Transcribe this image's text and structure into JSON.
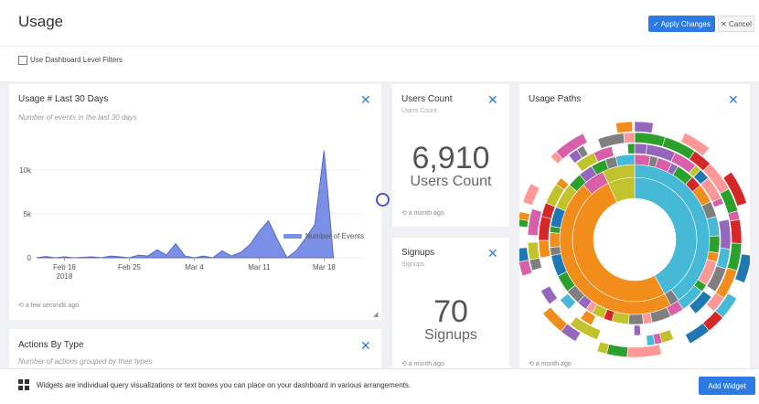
{
  "header": {
    "title": "Usage",
    "apply_label": "✓ Apply Changes",
    "cancel_label": "✕ Cancel"
  },
  "filters": {
    "label": "Use Dashboard Level Filters",
    "checked": false
  },
  "widgets": {
    "usage": {
      "title": "Usage # Last 30 Days",
      "subtitle": "Number of events in the last 30 days",
      "timestamp": "a few seconds ago"
    },
    "users_count": {
      "title": "Users Count",
      "subtitle": "Users Count",
      "value": "6,910",
      "label": "Users Count",
      "timestamp": "a month ago"
    },
    "signups": {
      "title": "Signups",
      "subtitle": "Signups",
      "value": "70",
      "label": "Signups",
      "timestamp": "a month ago"
    },
    "usage_paths": {
      "title": "Usage Paths",
      "timestamp": "a month ago"
    },
    "actions_by_type": {
      "title": "Actions By Type",
      "subtitle": "Number of actions grouped by their types"
    }
  },
  "footer": {
    "message": "Widgets are individual query visualizations or text boxes you can place on your dashboard in various arrangements.",
    "add_label": "Add Widget"
  },
  "icons": {
    "close": "close-icon",
    "clock": "clock-icon",
    "widgets": "widgets-icon",
    "resize": "resize-handle-icon",
    "drag": "drag-handle-icon"
  },
  "colors": {
    "accent": "#2c7be5",
    "series": "#7b8fe6"
  },
  "chart_data": {
    "type": "area",
    "title": "",
    "xlabel": "",
    "ylabel": "",
    "x_range": [
      "2018-02-15",
      "2018-03-22"
    ],
    "ylim": [
      0,
      13000
    ],
    "y_ticks": [
      0,
      5000,
      10000
    ],
    "y_tick_labels": [
      "0",
      "5k",
      "10k"
    ],
    "x_ticks": [
      "2018-02-18",
      "2018-02-25",
      "2018-03-04",
      "2018-03-11",
      "2018-03-18"
    ],
    "x_tick_labels": [
      "Feb 18",
      "Feb 25",
      "Mar 4",
      "Mar 11",
      "Mar 18"
    ],
    "x_tick_sublabel": "2018",
    "legend_position": "top-right",
    "series": [
      {
        "name": "Number of Events",
        "points": [
          [
            "2018-02-15",
            0
          ],
          [
            "2018-02-16",
            150
          ],
          [
            "2018-02-17",
            0
          ],
          [
            "2018-02-18",
            100
          ],
          [
            "2018-02-19",
            0
          ],
          [
            "2018-02-20",
            50
          ],
          [
            "2018-02-21",
            100
          ],
          [
            "2018-02-22",
            0
          ],
          [
            "2018-02-23",
            200
          ],
          [
            "2018-02-24",
            100
          ],
          [
            "2018-02-25",
            0
          ],
          [
            "2018-02-26",
            300
          ],
          [
            "2018-02-27",
            200
          ],
          [
            "2018-02-28",
            900
          ],
          [
            "2018-03-01",
            300
          ],
          [
            "2018-03-02",
            1600
          ],
          [
            "2018-03-03",
            200
          ],
          [
            "2018-03-04",
            0
          ],
          [
            "2018-03-05",
            200
          ],
          [
            "2018-03-06",
            0
          ],
          [
            "2018-03-07",
            800
          ],
          [
            "2018-03-08",
            200
          ],
          [
            "2018-03-09",
            600
          ],
          [
            "2018-03-10",
            1500
          ],
          [
            "2018-03-11",
            3000
          ],
          [
            "2018-03-12",
            4200
          ],
          [
            "2018-03-13",
            2000
          ],
          [
            "2018-03-14",
            0
          ],
          [
            "2018-03-15",
            800
          ],
          [
            "2018-03-16",
            2200
          ],
          [
            "2018-03-17",
            3800
          ],
          [
            "2018-03-18",
            12200
          ],
          [
            "2018-03-19",
            0
          ]
        ]
      }
    ]
  }
}
